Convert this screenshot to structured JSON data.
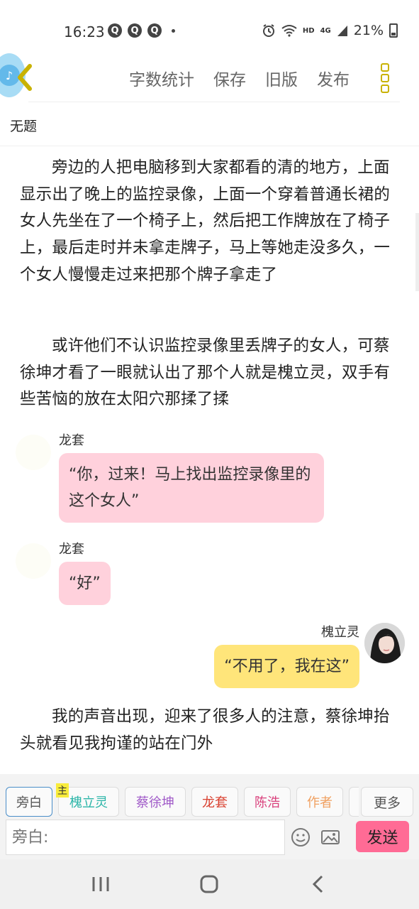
{
  "status_bar": {
    "time": "16:23",
    "notification_glyph": "Q",
    "hd": "HD",
    "network": "4G",
    "battery": "21%"
  },
  "toolbar": {
    "items": [
      "字数统计",
      "保存",
      "旧版",
      "发布"
    ]
  },
  "document": {
    "title": "无题"
  },
  "content": {
    "para1": "旁边的人把电脑移到大家都看的清的地方，上面显示出了晚上的监控录像，上面一个穿着普通长裙的女人先坐在了一个椅子上，然后把工作牌放在了椅子上，最后走时并未拿走牌子，马上等她走没多久，一个女人慢慢走过来把那个牌子拿走了",
    "para2": "或许他们不认识监控录像里丢牌子的女人，可蔡徐坤才看了一眼就认出了那个人就是槐立灵，双手有些苦恼的放在太阳穴那揉了揉",
    "msg1_speaker": "龙套",
    "msg1_text": "“你，过来！马上找出监控录像里的这个女人”",
    "msg2_speaker": "龙套",
    "msg2_text": "“好”",
    "msg3_speaker": "槐立灵",
    "msg3_text": "“不用了，我在这”",
    "para3": "我的声音出现，迎来了很多人的注意，蔡徐坤抬头就看见我拘谨的站在门外"
  },
  "roles": {
    "narrator": "旁白",
    "main_tag": "主",
    "r1": "槐立灵",
    "r2": "蔡徐坤",
    "r3": "龙套",
    "r4": "陈浩",
    "r5": "作者",
    "more": "更多",
    "colors": {
      "r1": "#2bb5a8",
      "r2": "#a05ac8",
      "r3": "#d9402f",
      "r4": "#d9407c",
      "r5": "#f0a060"
    }
  },
  "input": {
    "placeholder": "旁白:",
    "send": "发送"
  }
}
